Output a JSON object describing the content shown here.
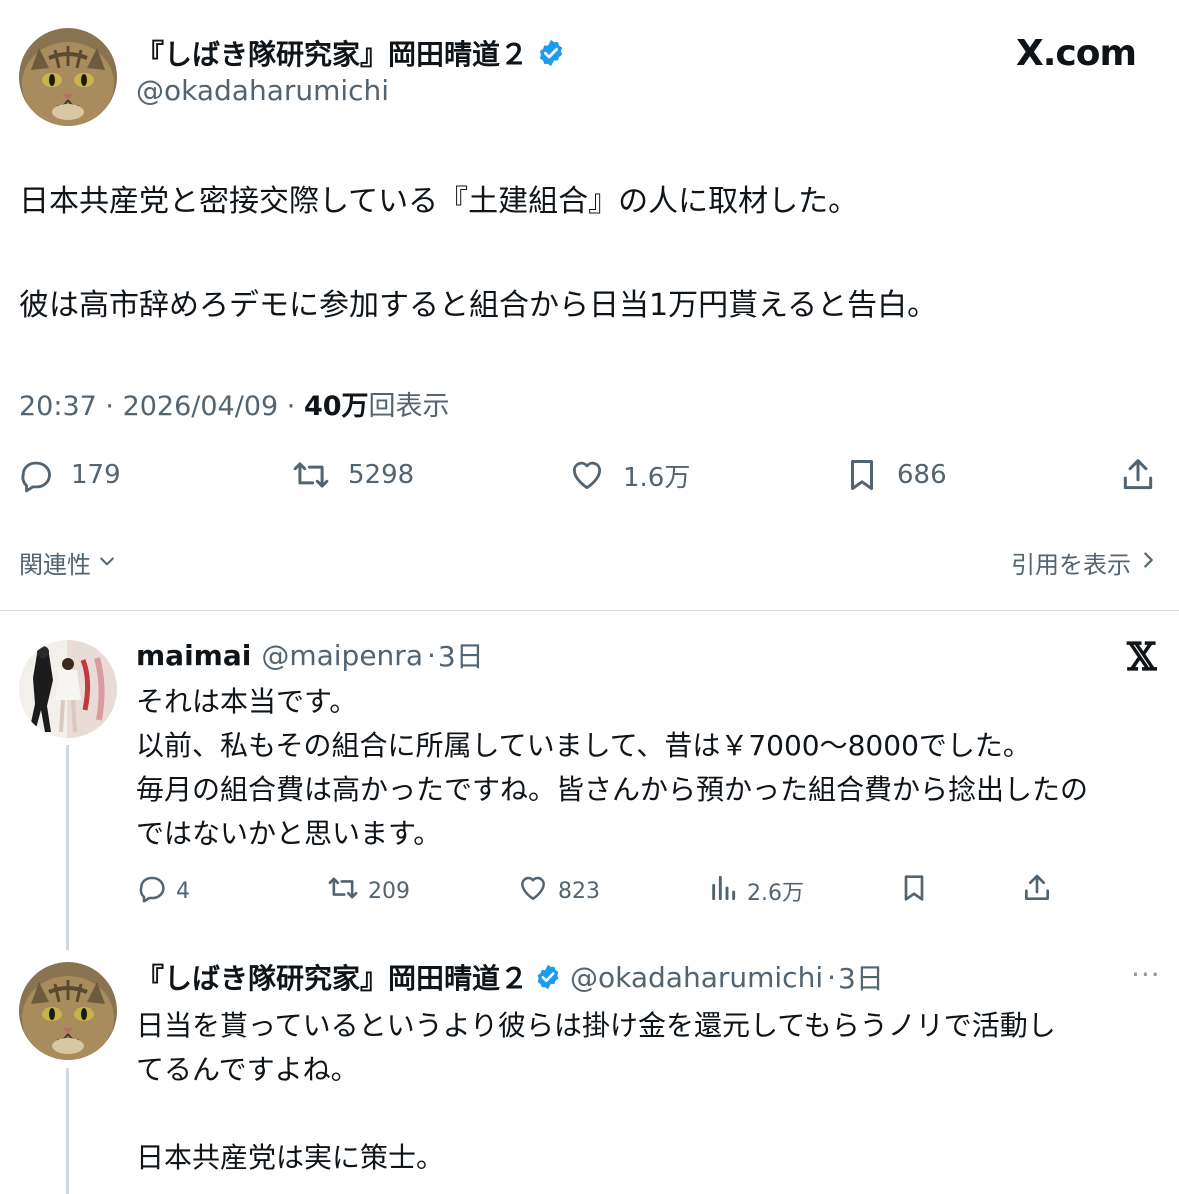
{
  "brand": {
    "site_label": "X.com"
  },
  "main_tweet": {
    "author": {
      "display_name": "『しばき隊研究家』岡田晴道２",
      "handle": "@okadaharumichi",
      "verified": true
    },
    "text_lines": [
      "日本共産党と密接交際している『土建組合』の人に取材した。",
      "彼は高市辞めろデモに参加すると組合から日当1万円貰えると告白。"
    ],
    "meta": {
      "time": "20:37",
      "date": "2026/04/09",
      "views_number": "40万",
      "views_suffix": "回表示",
      "separator": " · "
    },
    "actions": {
      "replies": "179",
      "reposts": "5298",
      "likes": "1.6万",
      "bookmarks": "686"
    },
    "relevance_label": "関連性",
    "quotes_label": "引用を表示"
  },
  "replies": [
    {
      "author": {
        "display_name": "maimai",
        "handle": "@maipenra",
        "time": "3日"
      },
      "text_lines": [
        "それは本当です。",
        "以前、私もその組合に所属していまして、昔は￥7000〜8000でした。",
        "毎月の組合費は高かったですね。皆さんから預かった組合費から捻出したの",
        "ではないかと思います。"
      ],
      "actions": {
        "replies": "4",
        "reposts": "209",
        "likes": "823",
        "views": "2.6万"
      }
    },
    {
      "author": {
        "display_name": "『しばき隊研究家』岡田晴道２",
        "handle": "@okadaharumichi",
        "time": "3日",
        "verified": true
      },
      "text_lines": [
        "日当を貰っているというより彼らは掛け金を還元してもらうノリで活動し",
        "てるんですよね。",
        "",
        "日本共産党は実に策士。"
      ]
    }
  ],
  "colors": {
    "text": "#0f1419",
    "secondary": "#536471",
    "verified_blue": "#1d9bf0",
    "divider": "#cfd9de"
  }
}
